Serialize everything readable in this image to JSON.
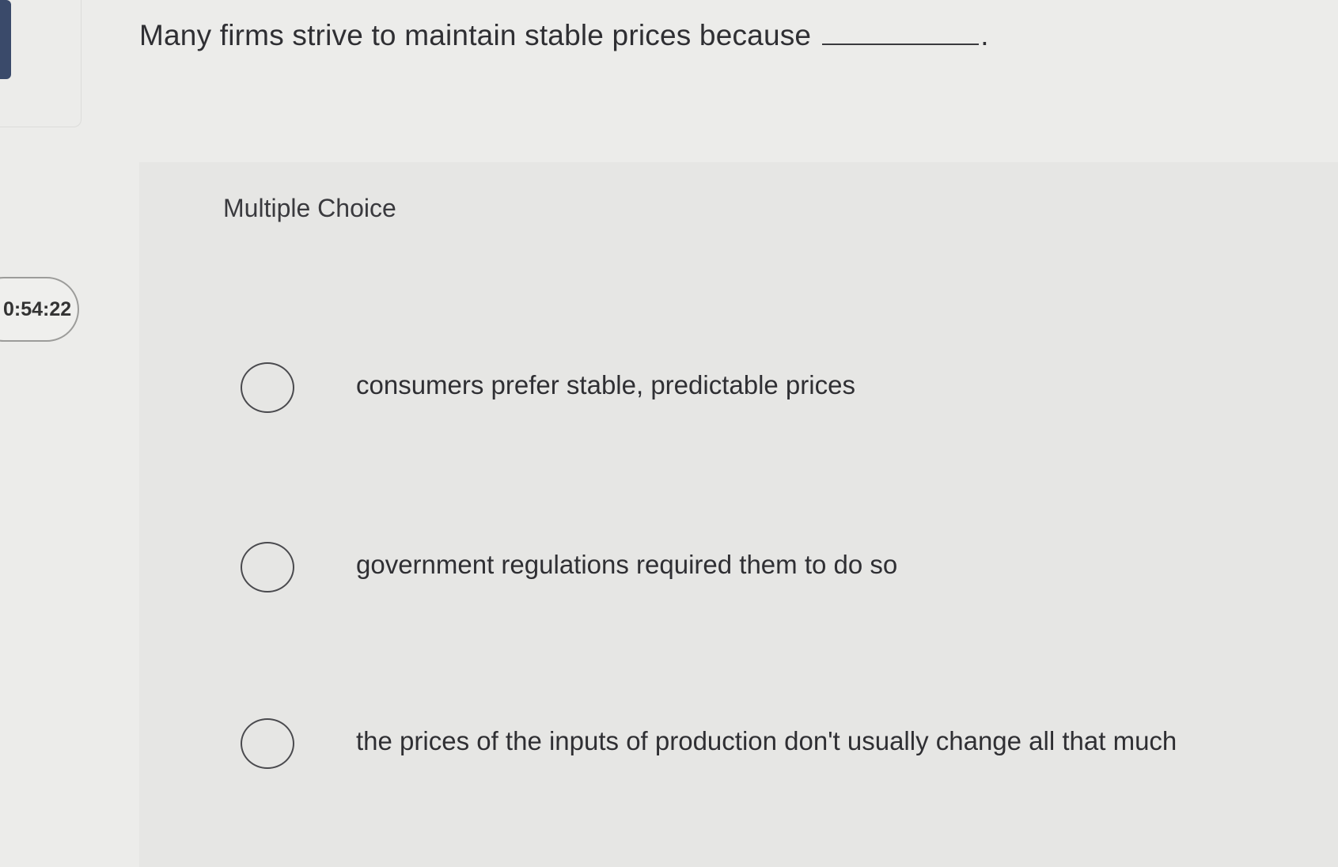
{
  "question": {
    "text": "Many firms strive to maintain stable prices because",
    "period": "."
  },
  "timer": {
    "value": "0:54:22"
  },
  "multiple_choice": {
    "heading": "Multiple Choice",
    "options": [
      {
        "label": "consumers prefer stable, predictable prices",
        "selected": false
      },
      {
        "label": "government regulations required them to do so",
        "selected": false
      },
      {
        "label": "the prices of the inputs of production don't usually change all that much",
        "selected": false
      }
    ]
  }
}
